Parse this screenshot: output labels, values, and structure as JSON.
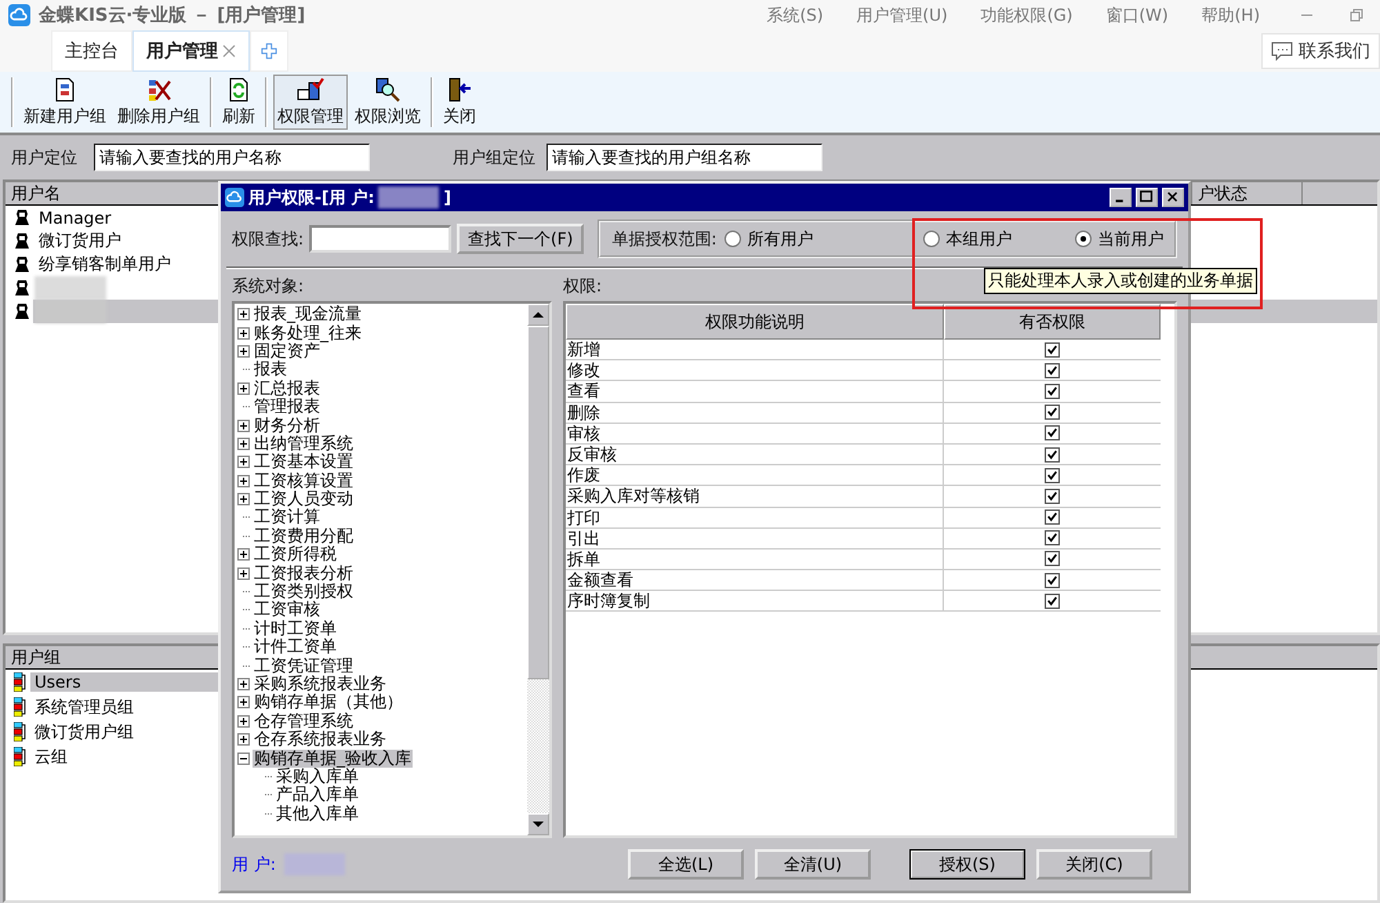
{
  "app": {
    "title": "金蝶KIS云·专业版 － [用户管理]",
    "menu": [
      "系统(S)",
      "用户管理(U)",
      "功能权限(G)",
      "窗口(W)",
      "帮助(H)"
    ],
    "tabs": [
      {
        "label": "主控台",
        "selected": false,
        "closable": false
      },
      {
        "label": "用户管理",
        "selected": true,
        "closable": true
      }
    ],
    "contact": "联系我们"
  },
  "toolbar": [
    {
      "label": "新建用户组",
      "kind": "new",
      "pressed": false
    },
    {
      "label": "删除用户组",
      "kind": "delete",
      "pressed": false
    },
    {
      "label": "刷新",
      "kind": "refresh",
      "pressed": false
    },
    {
      "label": "权限管理",
      "kind": "permission",
      "pressed": true
    },
    {
      "label": "权限浏览",
      "kind": "browse",
      "pressed": false
    },
    {
      "label": "关闭",
      "kind": "exit",
      "pressed": false
    }
  ],
  "user_search": {
    "label": "用户定位",
    "value": "请输入要查找的用户名称"
  },
  "group_search": {
    "label": "用户组定位",
    "value": "请输入要查找的用户组名称"
  },
  "users": {
    "columns": [
      "用户名",
      "户状态"
    ],
    "rows": [
      {
        "name": "Manager",
        "redacted": false,
        "selected": false
      },
      {
        "name": "微订货用户",
        "redacted": false,
        "selected": false
      },
      {
        "name": "纷享销客制单用户",
        "redacted": false,
        "selected": false
      },
      {
        "redacted": true,
        "selected": false
      },
      {
        "redacted": true,
        "selected": true
      }
    ]
  },
  "groups": {
    "column": "用户组",
    "rows": [
      {
        "name": "Users",
        "selected": true
      },
      {
        "name": "系统管理员组",
        "selected": false
      },
      {
        "name": "微订货用户组",
        "selected": false
      },
      {
        "name": "云组",
        "selected": false
      }
    ]
  },
  "dialog": {
    "title_prefix": "用户权限-[用 户:",
    "title_suffix": "]",
    "search_label": "权限查找:",
    "find_button": "查找下一个(F)",
    "scope_label": "单据授权范围:",
    "scope": [
      {
        "label": "所有用户",
        "selected": false
      },
      {
        "label": "本组用户",
        "selected": false
      },
      {
        "label": "当前用户",
        "selected": true
      }
    ],
    "tooltip": "只能处理本人录入或创建的业务单据",
    "tree_label": "系统对象:",
    "tree": [
      {
        "label": "报表_现金流量",
        "kind": "branch",
        "expanded": false,
        "selected": false
      },
      {
        "label": "账务处理_往来",
        "kind": "branch",
        "expanded": false,
        "selected": false
      },
      {
        "label": "固定资产",
        "kind": "branch",
        "expanded": false,
        "selected": false
      },
      {
        "label": "报表",
        "kind": "leaf",
        "selected": false
      },
      {
        "label": "汇总报表",
        "kind": "branch",
        "expanded": false,
        "selected": false
      },
      {
        "label": "管理报表",
        "kind": "leaf",
        "selected": false
      },
      {
        "label": "财务分析",
        "kind": "branch",
        "expanded": false,
        "selected": false
      },
      {
        "label": "出纳管理系统",
        "kind": "branch",
        "expanded": false,
        "selected": false
      },
      {
        "label": "工资基本设置",
        "kind": "branch",
        "expanded": false,
        "selected": false
      },
      {
        "label": "工资核算设置",
        "kind": "branch",
        "expanded": false,
        "selected": false
      },
      {
        "label": "工资人员变动",
        "kind": "branch",
        "expanded": false,
        "selected": false
      },
      {
        "label": "工资计算",
        "kind": "leaf",
        "selected": false
      },
      {
        "label": "工资费用分配",
        "kind": "leaf",
        "selected": false
      },
      {
        "label": "工资所得税",
        "kind": "branch",
        "expanded": false,
        "selected": false
      },
      {
        "label": "工资报表分析",
        "kind": "branch",
        "expanded": false,
        "selected": false
      },
      {
        "label": "工资类别授权",
        "kind": "leaf",
        "selected": false
      },
      {
        "label": "工资审核",
        "kind": "leaf",
        "selected": false
      },
      {
        "label": "计时工资单",
        "kind": "leaf",
        "selected": false
      },
      {
        "label": "计件工资单",
        "kind": "leaf",
        "selected": false
      },
      {
        "label": "工资凭证管理",
        "kind": "leaf",
        "selected": false
      },
      {
        "label": "采购系统报表业务",
        "kind": "branch",
        "expanded": false,
        "selected": false
      },
      {
        "label": "购销存单据（其他）",
        "kind": "branch",
        "expanded": false,
        "selected": false
      },
      {
        "label": "仓存管理系统",
        "kind": "branch",
        "expanded": false,
        "selected": false
      },
      {
        "label": "仓存系统报表业务",
        "kind": "branch",
        "expanded": false,
        "selected": false
      },
      {
        "label": "购销存单据_验收入库",
        "kind": "branch",
        "expanded": true,
        "selected": true,
        "children": [
          {
            "label": "采购入库单",
            "kind": "leaf",
            "selected": false
          },
          {
            "label": "产品入库单",
            "kind": "leaf",
            "selected": false
          },
          {
            "label": "其他入库单",
            "kind": "leaf",
            "selected": false
          }
        ]
      }
    ],
    "grid_label": "权限:",
    "columns": [
      "权限功能说明",
      "有否权限"
    ],
    "rows": [
      {
        "label": "新增",
        "checked": true
      },
      {
        "label": "修改",
        "checked": true
      },
      {
        "label": "查看",
        "checked": true
      },
      {
        "label": "删除",
        "checked": true
      },
      {
        "label": "审核",
        "checked": true
      },
      {
        "label": "反审核",
        "checked": true
      },
      {
        "label": "作废",
        "checked": true
      },
      {
        "label": "采购入库对等核销",
        "checked": true
      },
      {
        "label": "打印",
        "checked": true
      },
      {
        "label": "引出",
        "checked": true
      },
      {
        "label": "拆单",
        "checked": true
      },
      {
        "label": "金额查看",
        "checked": true
      },
      {
        "label": "序时簿复制",
        "checked": true
      }
    ],
    "user_label": "用 户:",
    "buttons": [
      {
        "label": "全选(L)",
        "default": false
      },
      {
        "label": "全清(U)",
        "default": false
      },
      {
        "label": "授权(S)",
        "default": true
      },
      {
        "label": "关闭(C)",
        "default": false
      }
    ]
  }
}
